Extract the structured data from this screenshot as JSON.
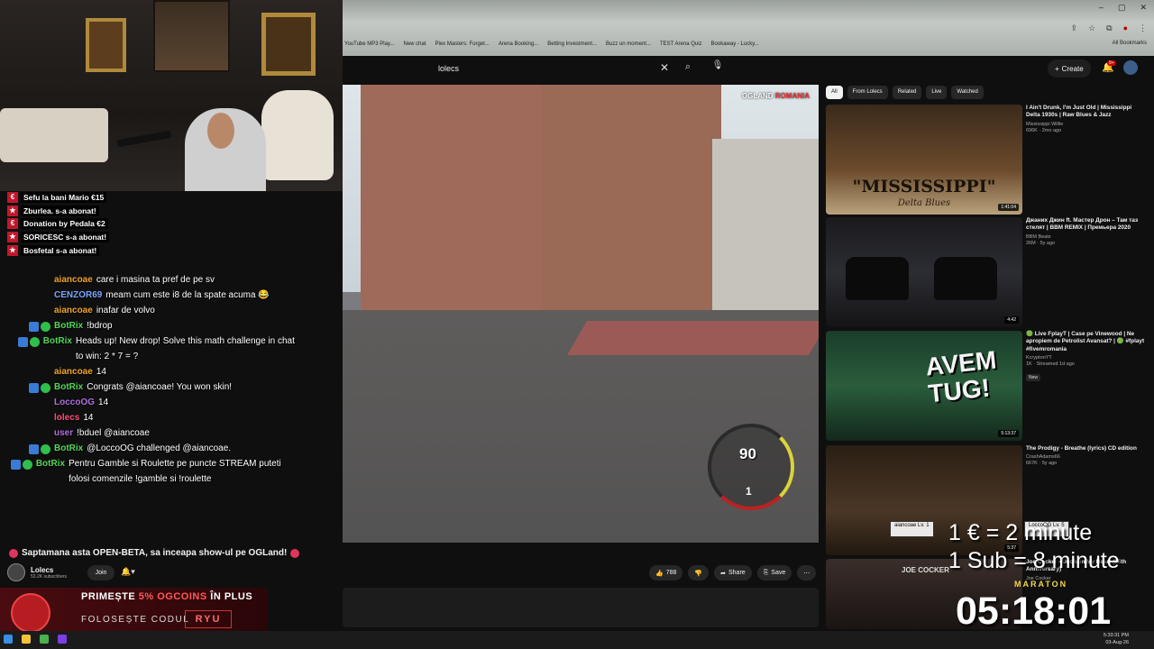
{
  "browser": {
    "bookmarks": [
      "YouTube MP3 Play...",
      "New chat",
      "Plex Masters: Forget...",
      "Arena Booking...",
      "Betting Investment...",
      "Buzz un moment...",
      "TEST Arena Quiz",
      "Bookaway - Lucky..."
    ],
    "all_bookmarks": "All Bookmarks",
    "window_controls": [
      "–",
      "▢",
      "✕"
    ]
  },
  "youtube": {
    "search_value": "lolecs",
    "create_label": "Create",
    "notif_count": "9+"
  },
  "video": {
    "overlay_brand": "OGLAND",
    "overlay_country": "ROMANIA",
    "speed": "90",
    "gear": "1",
    "title": "Saptamana asta OPEN-BETA, sa inceapa show-ul pe OGLand!",
    "channel_name": "Lolecs",
    "channel_subs": "53.2K subscribers",
    "join_label": "Join",
    "likes": "788",
    "share_label": "Share",
    "save_label": "Save",
    "more_label": "⋯"
  },
  "alerts": [
    {
      "icon": "€",
      "text": "Sefu la bani Mario €15"
    },
    {
      "icon": "★",
      "text": "Zburlea. s-a abonat!"
    },
    {
      "icon": "€",
      "text": "Donation by Pedala €2"
    },
    {
      "icon": "★",
      "text": "SORICESC s-a abonat!"
    },
    {
      "icon": "★",
      "text": "Bosfetal s-a abonat!"
    }
  ],
  "chat": [
    {
      "badges": [],
      "user": "aiancoae",
      "color": "#f2a42a",
      "text": "care i masina ta pref de pe sv"
    },
    {
      "badges": [],
      "user": "CENZOR69",
      "color": "#7aa5ff",
      "text": "meam cum este i8 de la spate acuma 😂"
    },
    {
      "badges": [],
      "user": "aiancoae",
      "color": "#f2a42a",
      "text": "inafar de volvo"
    },
    {
      "badges": [
        "blue",
        "green"
      ],
      "user": "BotRix",
      "color": "#55d65a",
      "text": "!bdrop"
    },
    {
      "badges": [
        "blue",
        "green"
      ],
      "user": "BotRix",
      "color": "#55d65a",
      "text": "Heads up! New drop! Solve this math challenge in chat to win: 2 * 7 = ?"
    },
    {
      "badges": [],
      "user": "aiancoae",
      "color": "#f2a42a",
      "text": "14"
    },
    {
      "badges": [
        "blue",
        "green"
      ],
      "user": "BotRix",
      "color": "#55d65a",
      "text": "Congrats @aiancoae! You won skin!"
    },
    {
      "badges": [],
      "user": "LoccoOG",
      "color": "#b06fe0",
      "text": "14"
    },
    {
      "badges": [],
      "user": "lolecs",
      "color": "#ff4d7a",
      "text": "14"
    },
    {
      "badges": [],
      "user": "user",
      "color": "#b06fe0",
      "text": "!bduel @aiancoae"
    },
    {
      "badges": [
        "blue",
        "green"
      ],
      "user": "BotRix",
      "color": "#55d65a",
      "text": "@LoccoOG challenged @aiancoae."
    },
    {
      "badges": [
        "blue",
        "green"
      ],
      "user": "BotRix",
      "color": "#55d65a",
      "text": "Pentru Gamble si Roulette pe puncte STREAM puteti folosi comenzile !gamble si !roulette"
    }
  ],
  "promo": {
    "line1_prefix": "PRIMEȘTE ",
    "line1_highlight": "5% OGCOINS",
    "line1_suffix": " ÎN PLUS",
    "line2": "FOLOSEȘTE CODUL",
    "code": "RYU"
  },
  "sidebar": {
    "chips": [
      "All",
      "From Lolecs",
      "Related",
      "Live",
      "Watched"
    ],
    "recs": [
      {
        "title": "I Ain't Drunk, I'm Just Old | Mississippi Delta 1930s | Raw Blues & Jazz",
        "channel": "Mississippi Willie",
        "meta": "696K · 2mo ago",
        "duration": "1:41:04",
        "thumb_big": "\"MISSISSIPPI\"",
        "thumb_small": "Delta Blues"
      },
      {
        "title": "Джаних Джин ft. Мастер Дрон – Там таз стелят | BBM REMIX | Премьера 2020",
        "channel": "BBM Beats",
        "meta": "26M · 5y ago",
        "duration": "4:42"
      },
      {
        "title": "🟢 Live FplayT | Case pe Vinewood | Ne apropiem de Petrolist Avansat? | 🟢 #fplayt #fivemromania",
        "channel": "KcryptonYT",
        "meta": "1K · Streamed 1d ago",
        "duration": "5:13:37",
        "tag": "New",
        "thumb_big": "AVEM TUG!"
      },
      {
        "title": "The Prodigy - Breathe (lyrics) CD edition",
        "channel": "CrashAdams66",
        "meta": "667K · 5y ago",
        "duration": "5:37"
      },
      {
        "title": "Joe Cocker - Unchain My Heart (25th Anniversary)",
        "channel": "Joe Cocker",
        "meta": "",
        "duration": "",
        "thumb_big": "JOE COCKER"
      }
    ]
  },
  "overlay": {
    "line1": "1 € = 2 minute",
    "line2": "1 Sub = 8 minute",
    "maraton": "MARATON",
    "timer": "05:18:01",
    "lvl1_name": "aiancoae",
    "lvl1_level": "Lv. 1",
    "lvl2_name": "LoccoOG",
    "lvl2_level": "Lv. 5"
  },
  "taskbar": {
    "time": "5:33:31 PM",
    "date": "03-Aug-26"
  }
}
